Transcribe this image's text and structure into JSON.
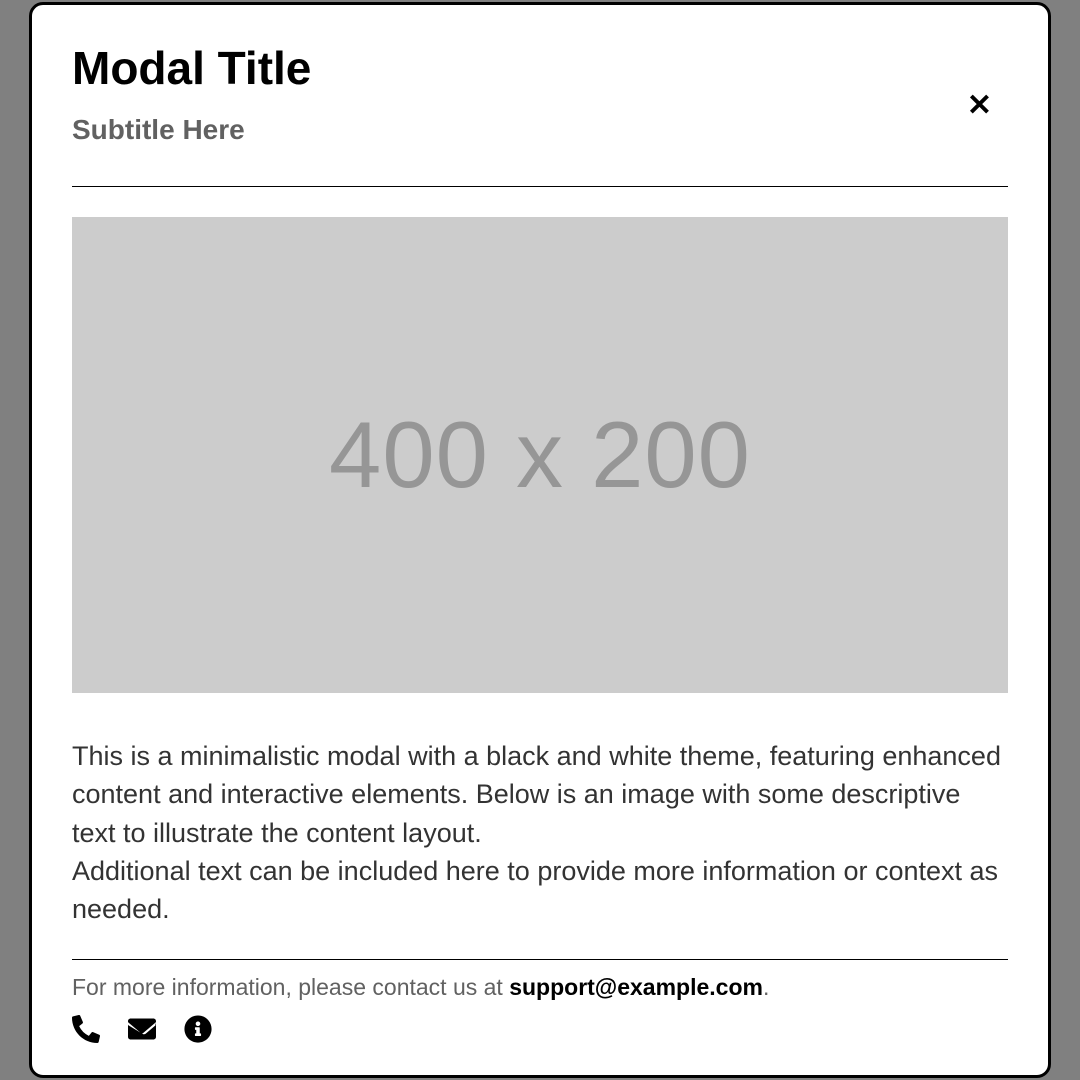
{
  "modal": {
    "title": "Modal Title",
    "subtitle": "Subtitle Here",
    "close_label": "✕",
    "image_placeholder": "400 x 200",
    "paragraph1": "This is a minimalistic modal with a black and white theme, featuring enhanced content and interactive elements. Below is an image with some descriptive text to illustrate the content layout.",
    "paragraph2": "Additional text can be included here to provide more information or context as needed.",
    "footer_prefix": "For more information, please contact us at ",
    "footer_email": "support@example.com",
    "footer_suffix": "."
  }
}
